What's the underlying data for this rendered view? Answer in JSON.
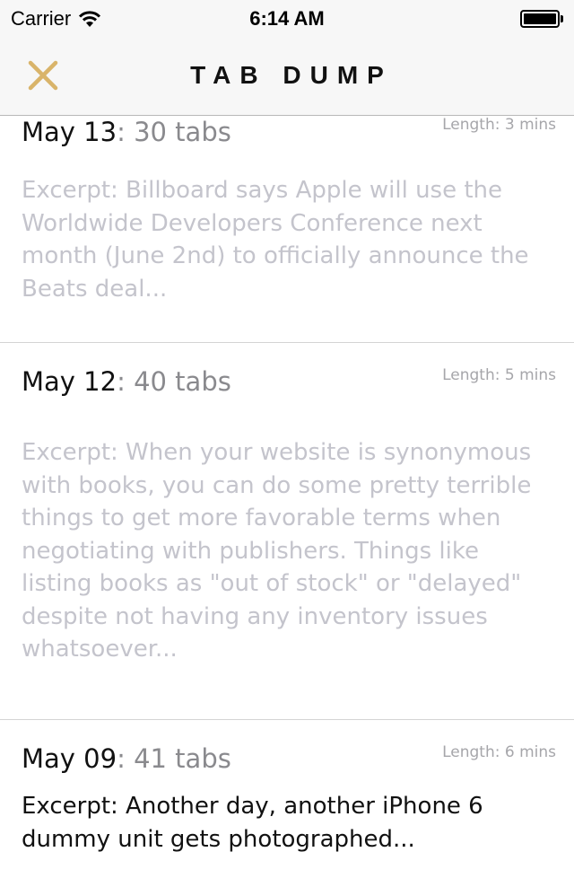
{
  "status_bar": {
    "carrier": "Carrier",
    "time": "6:14 AM"
  },
  "nav": {
    "title": "TAB DUMP",
    "close_icon_color": "#d9b46a"
  },
  "entries": [
    {
      "date": "May 13",
      "tabs": ": 30 tabs",
      "length": "Length: 3 mins",
      "excerpt": "Excerpt: Billboard says Apple will use the Worldwide Developers Conference next month (June 2nd) to officially announce the Beats deal...",
      "read": true
    },
    {
      "date": "May 12",
      "tabs": ": 40 tabs",
      "length": "Length: 5 mins",
      "excerpt": "Excerpt: When your website is synonymous with books, you can do some pretty terrible things to get more favorable terms when negotiating with publishers. Things like listing books as \"out of stock\" or \"delayed\" despite not having any inventory issues whatsoever...",
      "read": true
    },
    {
      "date": "May 09",
      "tabs": ": 41 tabs",
      "length": "Length: 6 mins",
      "excerpt": "Excerpt: Another day, another iPhone 6 dummy unit gets photographed...",
      "read": false
    }
  ]
}
